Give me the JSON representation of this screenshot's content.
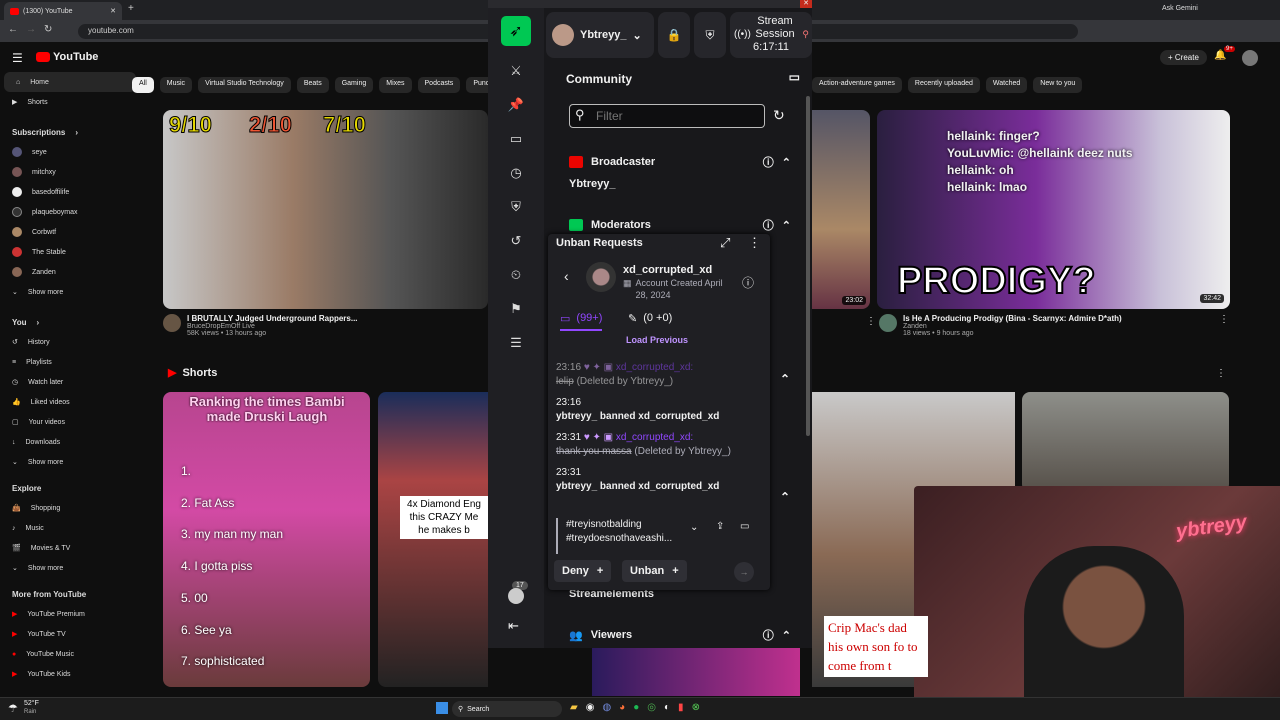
{
  "browser": {
    "tab_title": "(1300) YouTube",
    "url": "youtube.com",
    "ask_gemini": "Ask Gemini"
  },
  "youtube": {
    "logo": "YouTube",
    "create_label": "Create",
    "notif_count": "9+",
    "chips": [
      "All",
      "Music",
      "Virtual Studio Technology",
      "Beats",
      "Gaming",
      "Mixes",
      "Podcasts",
      "Punch"
    ],
    "chips_right": [
      "Action-adventure games",
      "Recently uploaded",
      "Watched",
      "New to you"
    ],
    "sidebar": {
      "top": [
        "Home",
        "Shorts"
      ],
      "subs_title": "Subscriptions",
      "subs": [
        "seye",
        "mitchxy",
        "basedoffilife",
        "plaqueboymax",
        "Corbwtf",
        "The Stable",
        "Zanden",
        "Show more"
      ],
      "you_title": "You",
      "you": [
        "History",
        "Playlists",
        "Watch later",
        "Liked videos",
        "Your videos",
        "Downloads",
        "Show more"
      ],
      "explore_title": "Explore",
      "explore": [
        "Shopping",
        "Music",
        "Movies & TV",
        "Show more"
      ],
      "more_title": "More from YouTube",
      "more": [
        "YouTube Premium",
        "YouTube TV",
        "YouTube Music",
        "YouTube Kids"
      ]
    },
    "video1": {
      "title": "I BRUTALLY Judged Underground Rappers...",
      "channel": "BruceDropEmOff Live",
      "stats": "58K views • 13 hours ago",
      "ratings": [
        "9/10",
        "2/10",
        "7/10"
      ]
    },
    "video2": {
      "title": "Is He A Producing Prodigy (Bina - Scarnyx: Admire D*ath)",
      "channel": "Zanden",
      "stats": "18 views • 9 hours ago",
      "duration": "32:42",
      "overlay": "PRODIGY?",
      "chat_lines": [
        "hellaink: finger?",
        "YouLuvMic: @hellaink deez nuts",
        "hellaink: oh",
        "hellaink: lmao"
      ]
    },
    "duration_mid": "23:02",
    "shorts_title": "Shorts",
    "short1": {
      "caption": "Ranking the times Bambi made Druski Laugh",
      "items": [
        "1.",
        "2. Fat Ass",
        "3. my man my man",
        "4. I gotta piss",
        "5. 00",
        "6. See ya",
        "7. sophisticated"
      ]
    },
    "short2_caption": "4x Diamond Eng this CRAZY Me he makes b",
    "short_right_caption": "Crip Mac's dad his own son fo to come from t"
  },
  "taskbar": {
    "weather_temp": "52°F",
    "weather_desc": "Rain",
    "search": "Search"
  },
  "panel": {
    "username": "Ybtreyy_",
    "stream_session_label": "Stream Session",
    "stream_time": "6:17:11",
    "community_title": "Community",
    "filter_placeholder": "Filter",
    "broadcaster_label": "Broadcaster",
    "broadcaster_name": "Ybtreyy_",
    "moderators_label": "Moderators",
    "streamelements_label": "Streamelements",
    "viewers_label": "Viewers",
    "rail_badge": "17"
  },
  "unban": {
    "title": "Unban Requests",
    "user": "xd_corrupted_xd",
    "account_created": "Account Created April 28, 2024",
    "messages_count": "(99+)",
    "mod_actions": "(0 +0)",
    "load_previous": "Load Previous",
    "log": [
      {
        "time": "23:16",
        "user": "xd_corrupted_xd:",
        "text": "lelip",
        "note": "(Deleted by Ybtreyy_)"
      },
      {
        "time": "23:16",
        "text": "ybtreyy_ banned xd_corrupted_xd"
      },
      {
        "time": "23:31",
        "user": "xd_corrupted_xd:",
        "text": "thank you massa",
        "note": "(Deleted by Ybtreyy_)"
      },
      {
        "time": "23:31",
        "text": "ybtreyy_ banned xd_corrupted_xd"
      }
    ],
    "request_text_1": "#treyisnotbalding",
    "request_text_2": "#treydoesnothaveashi...",
    "deny_label": "Deny",
    "unban_label": "Unban"
  },
  "webcam_sign": "ybtreyy",
  "colors": {
    "accent": "#9147ff",
    "panel_green": "#00c853",
    "broadcaster_red": "#eb0400",
    "yt_red": "#ff0000"
  }
}
